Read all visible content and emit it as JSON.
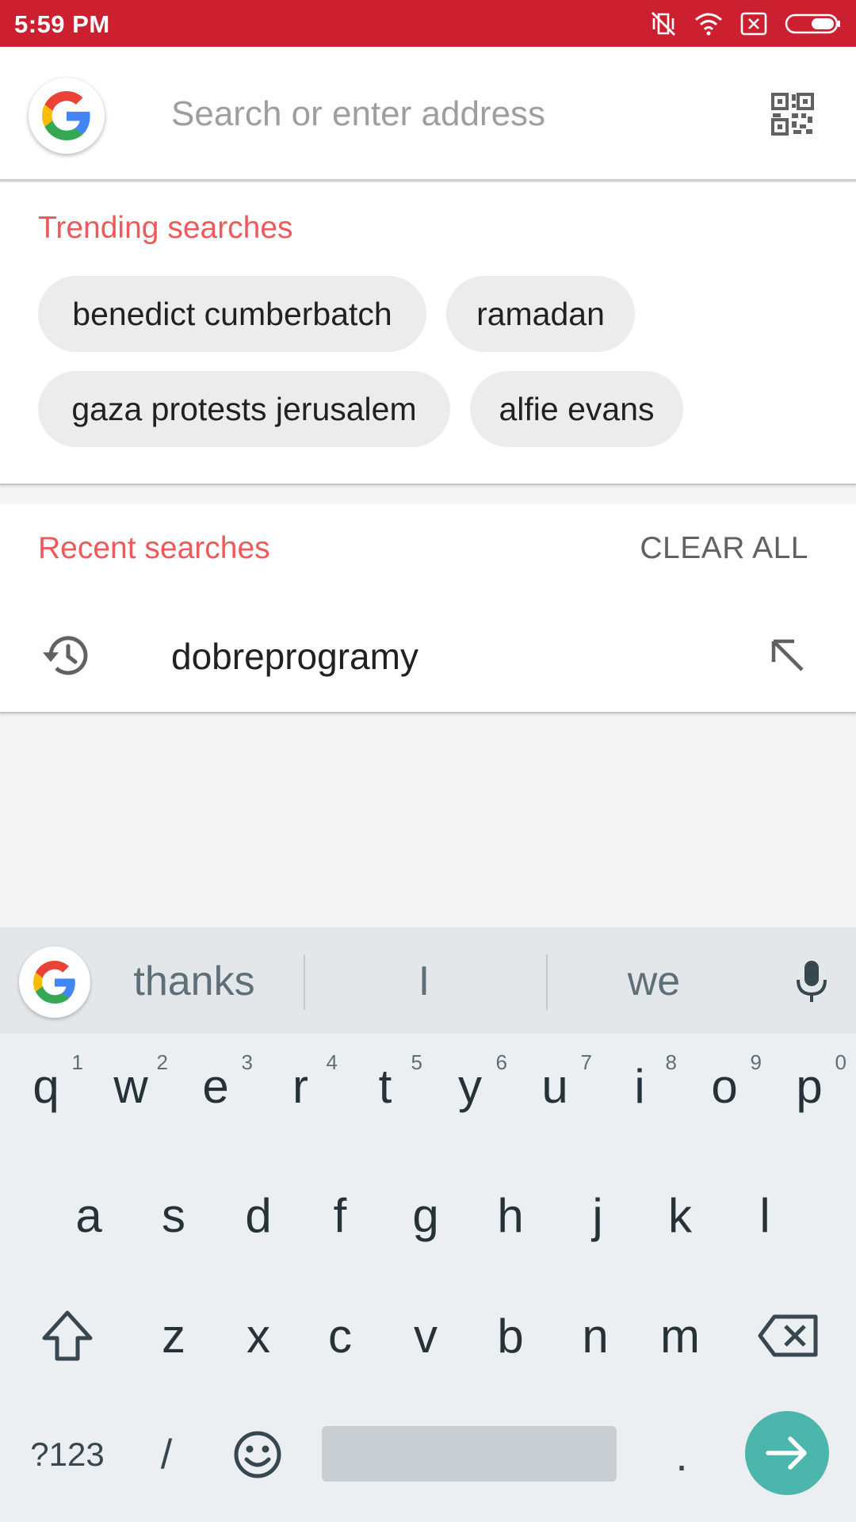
{
  "status_bar": {
    "time": "5:59 PM",
    "icons": [
      "vibrate-off-icon",
      "wifi-icon",
      "no-sim-icon",
      "battery-icon"
    ]
  },
  "search": {
    "placeholder": "Search or enter address",
    "value": "",
    "left_icon": "google-logo",
    "right_icon": "qr-code-icon"
  },
  "trending": {
    "title": "Trending searches",
    "chips": [
      "benedict cumberbatch",
      "ramadan",
      "gaza protests jerusalem",
      "alfie evans"
    ]
  },
  "recent": {
    "title": "Recent searches",
    "clear_label": "CLEAR ALL",
    "items": [
      {
        "text": "dobreprogramy",
        "icon": "history-icon",
        "action_icon": "arrow-up-left-icon"
      }
    ]
  },
  "keyboard": {
    "suggestions": [
      "thanks",
      "I",
      "we"
    ],
    "row1": [
      {
        "k": "q",
        "n": "1"
      },
      {
        "k": "w",
        "n": "2"
      },
      {
        "k": "e",
        "n": "3"
      },
      {
        "k": "r",
        "n": "4"
      },
      {
        "k": "t",
        "n": "5"
      },
      {
        "k": "y",
        "n": "6"
      },
      {
        "k": "u",
        "n": "7"
      },
      {
        "k": "i",
        "n": "8"
      },
      {
        "k": "o",
        "n": "9"
      },
      {
        "k": "p",
        "n": "0"
      }
    ],
    "row2": [
      "a",
      "s",
      "d",
      "f",
      "g",
      "h",
      "j",
      "k",
      "l"
    ],
    "row3": [
      "z",
      "x",
      "c",
      "v",
      "b",
      "n",
      "m"
    ],
    "symbols_label": "?123",
    "slash_label": "/",
    "period_label": ".",
    "colors": {
      "enter": "#4db6ac",
      "accent": "#ee5a5c",
      "status_bar": "#cc1f2f"
    }
  }
}
